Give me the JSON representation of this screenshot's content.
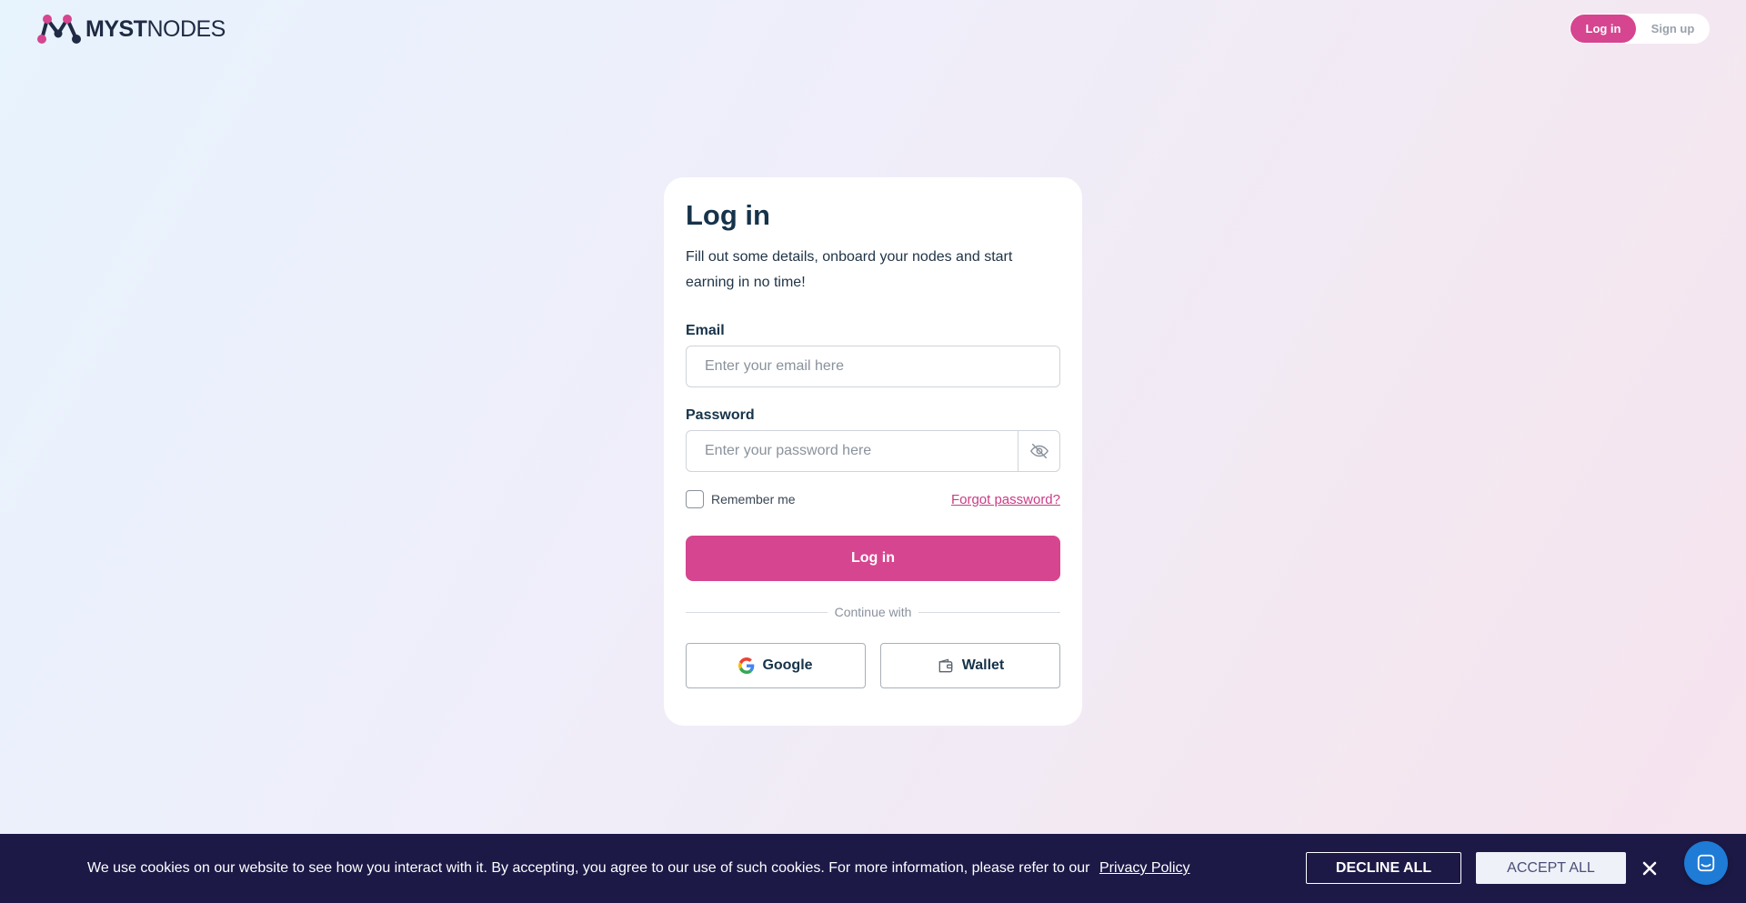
{
  "header": {
    "logo_text_bold": "MYST",
    "logo_text_light": "NODES",
    "login_pill": "Log in",
    "signup_pill": "Sign up"
  },
  "login_card": {
    "title": "Log in",
    "subtitle": "Fill out some details, onboard your nodes and start earning in no time!",
    "email_label": "Email",
    "email_placeholder": "Enter your email here",
    "email_value": "",
    "password_label": "Password",
    "password_placeholder": "Enter your password here",
    "password_value": "",
    "remember_label": "Remember me",
    "remember_checked": false,
    "forgot_link": "Forgot password?",
    "login_button": "Log in",
    "divider_text": "Continue with",
    "google_button": "Google",
    "wallet_button": "Wallet"
  },
  "cookie_bar": {
    "message": "We use cookies on our website to see how you interact with it. By accepting, you agree to our use of such cookies. For more information, please refer to our",
    "policy_link": "Privacy Policy",
    "decline_button": "DECLINE ALL",
    "accept_button": "ACCEPT ALL"
  },
  "icons": {
    "password_toggle": "eye-off-icon",
    "google": "google-icon",
    "wallet": "wallet-icon",
    "close": "close-icon",
    "chat": "chat-icon"
  },
  "colors": {
    "brand_pink": "#d6458f",
    "text_dark": "#16334a",
    "cookie_bg": "#1c1947",
    "chat_blue": "#1e7bd6"
  }
}
